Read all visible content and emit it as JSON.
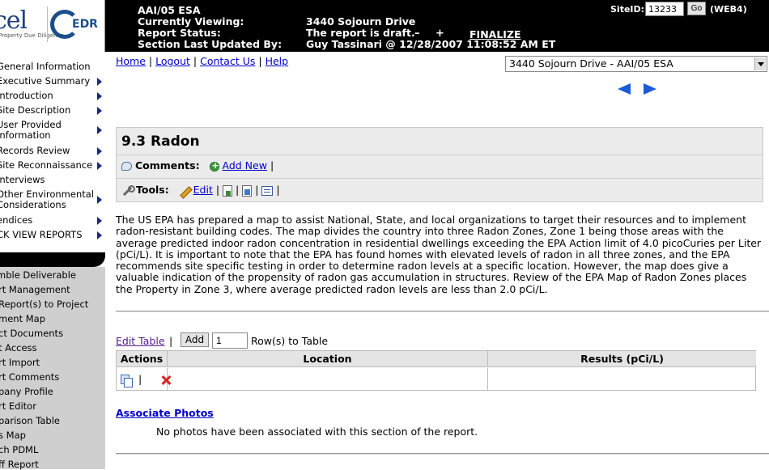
{
  "header": {
    "report_name": "AAI/05 ESA",
    "viewing_label": "Currently Viewing:",
    "viewing_value": "3440 Sojourn Drive",
    "status_label": "Report Status:",
    "status_value": "The report is draft.",
    "minus_label": "–",
    "plus_label": "+",
    "finalize_label": "FINALIZE",
    "updated_label": "Section Last Updated By:",
    "updated_value": "Guy Tassinari @ 12/28/2007 11:08:52 AM ET",
    "siteid_label": "SiteID:",
    "siteid_value": "13233",
    "go_label": "Go",
    "server_label": "(WEB4)",
    "logo_text": "cel",
    "logo_tagline": "Property Due Diligence",
    "logo_edr": "EDR"
  },
  "sidebar": {
    "items": [
      {
        "label": "General Information",
        "arrow": false
      },
      {
        "label": "Executive Summary",
        "arrow": true
      },
      {
        "label": "Introduction",
        "arrow": true
      },
      {
        "label": "Site Description",
        "arrow": true
      },
      {
        "label": "User Provided",
        "label2": "Information",
        "arrow": true
      },
      {
        "label": "Records Review",
        "arrow": true
      },
      {
        "label": "Site Reconnaissance",
        "arrow": true
      },
      {
        "label": "Interviews",
        "arrow": false
      },
      {
        "label": "Other Environmental",
        "label2": "Considerations",
        "arrow": true
      },
      {
        "label": "endices",
        "arrow": true
      },
      {
        "label": "CK VIEW REPORTS",
        "arrow": true
      }
    ],
    "tools": [
      "mble Deliverable",
      "rt Management",
      "Report(s) to Project",
      "ment Map",
      "ct Documents",
      "t Access",
      "rt Import",
      "rt Comments",
      "pany Profile",
      "rt Editor",
      "parison Table",
      "s Map",
      "ch PDML",
      "ff Report"
    ]
  },
  "top_links": {
    "home": "Home",
    "logout": "Logout",
    "contact": "Contact Us",
    "help": "Help",
    "sep": "|"
  },
  "report_select": {
    "value": "3440 Sojourn Drive - AAI/05 ESA"
  },
  "section": {
    "title": "9.3 Radon",
    "comments_label": "Comments:",
    "add_new_label": "Add New",
    "tools_label": "Tools:",
    "edit_label": "Edit",
    "pipe": "|"
  },
  "body_text": "The US EPA has prepared a map to assist National, State, and local organizations to target their resources and to implement radon-resistant building codes.  The map divides the country into three Radon Zones, Zone 1 being those areas with the average predicted indoor radon concentration in residential dwellings exceeding the EPA Action limit of 4.0 picoCuries per Liter (pCi/L).  It is important to note that the EPA has found homes with elevated levels of radon in all three zones, and the EPA recommends site specific testing in order to determine radon levels at a specific location.  However, the map does give a valuable indication of the propensity of radon gas accumulation in structures.  Review of the EPA Map of Radon Zones places the Property in Zone 3, where average predicted radon levels are less than 2.0 pCi/L.",
  "table_controls": {
    "edit_table": "Edit Table",
    "pipe": "|",
    "add_label": "Add",
    "rows_value": "1",
    "rows_suffix": "Row(s) to Table"
  },
  "table": {
    "headers": [
      "Actions",
      "Location",
      "Results (pCi/L)"
    ],
    "action_sep": "|",
    "rows": [
      {
        "location": "",
        "results": ""
      }
    ]
  },
  "photos": {
    "link": "Associate Photos",
    "empty": "No photos have been associated with this section of the report."
  },
  "colors": {
    "header_bg": "#000000",
    "link": "#0000cc",
    "nav_arrow": "#1a2a7a",
    "nav_tools_bg": "#cfcfcf",
    "section_bg": "#ebebeb",
    "delete_icon": "#dd2222"
  }
}
